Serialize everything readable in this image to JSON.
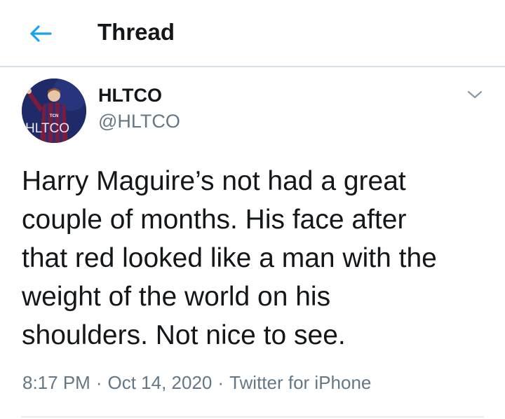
{
  "header": {
    "title": "Thread"
  },
  "tweet": {
    "display_name": "HLTCO",
    "handle": "@HLTCO",
    "avatar_text": "HLTCO",
    "text": "Harry Maguire’s not had a great\ncouple of months. His face after\nthat red looked like a man with the\nweight of the world on his\nshoulders. Not nice to see.",
    "time": "8:17 PM",
    "date": "Oct 14, 2020",
    "source": "Twitter for iPhone",
    "separator": "·"
  },
  "icons": {
    "back": "arrow-left-icon",
    "caret": "chevron-down-icon"
  },
  "colors": {
    "accent": "#1da1f2",
    "secondary_text": "#657786",
    "divider": "#d6dfe6"
  }
}
